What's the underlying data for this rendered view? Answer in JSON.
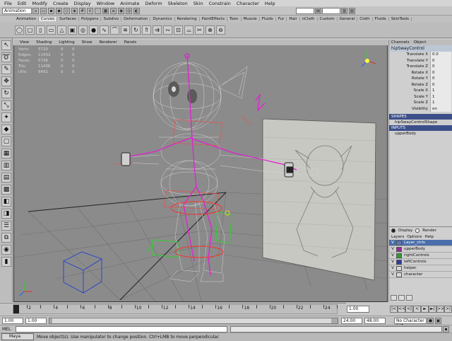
{
  "menubar": {
    "items": [
      "File",
      "Edit",
      "Modify",
      "Create",
      "Display",
      "Window",
      "Animate",
      "Deform",
      "Skeleton",
      "Skin",
      "Constrain",
      "Character",
      "Help"
    ]
  },
  "statusline": {
    "mode": "Animation",
    "field1": "",
    "field2": ""
  },
  "shelf": {
    "tabs": [
      "Animation",
      "Curves",
      "Surfaces",
      "Polygons",
      "Subdivs",
      "Deformation",
      "Dynamics",
      "Rendering",
      "PaintEffects",
      "Toon",
      "Muscle",
      "Fluids",
      "Fur",
      "Hair",
      "nCloth",
      "Custom",
      "General",
      "Cloth",
      "Fluids",
      "SkinTools"
    ],
    "active_tab": 1,
    "buttons": [
      "circle",
      "square",
      "cylinder",
      "plane",
      "cone",
      "cube",
      "torus",
      "sphere",
      "curve",
      "arc",
      "loft",
      "revolve",
      "extrude",
      "birail",
      "sweep",
      "boundary",
      "fillet",
      "trim",
      "attach",
      "detach"
    ]
  },
  "toolbox": {
    "tools": [
      "select",
      "lasso",
      "paint",
      "move",
      "rotate",
      "scale",
      "manip",
      "last",
      "layout-single",
      "layout-quad",
      "layout-side",
      "layout-stack",
      "layout-grid",
      "layout-persp",
      "layout-graph",
      "outliner",
      "hypergraph",
      "render",
      "script"
    ]
  },
  "viewport": {
    "menu": [
      "View",
      "Shading",
      "Lighting",
      "Show",
      "Renderer",
      "Panels"
    ],
    "hud": [
      {
        "label": "Verts:",
        "value": "5720",
        "a": "0",
        "b": "0"
      },
      {
        "label": "Edges:",
        "value": "11432",
        "a": "0",
        "b": "0"
      },
      {
        "label": "Faces:",
        "value": "5736",
        "a": "0",
        "b": "0"
      },
      {
        "label": "Tris:",
        "value": "11436",
        "a": "0",
        "b": "0"
      },
      {
        "label": "UVs:",
        "value": "6491",
        "a": "0",
        "b": "0"
      }
    ],
    "axis_x": "X",
    "axis_y": "Y",
    "axis_z": "Z"
  },
  "channelbox": {
    "tabs": [
      "Channels",
      "Object"
    ],
    "node": "hipSwayControl",
    "attrs": [
      {
        "label": "Translate X",
        "value": "0.0"
      },
      {
        "label": "Translate Y",
        "value": "0"
      },
      {
        "label": "Translate Z",
        "value": "0"
      },
      {
        "label": "Rotate X",
        "value": "0"
      },
      {
        "label": "Rotate Y",
        "value": "0"
      },
      {
        "label": "Rotate Z",
        "value": "0"
      },
      {
        "label": "Scale X",
        "value": "1"
      },
      {
        "label": "Scale Y",
        "value": "1"
      },
      {
        "label": "Scale Z",
        "value": "1"
      },
      {
        "label": "Visibility",
        "value": "on"
      }
    ],
    "shapes_header": "SHAPES",
    "shape_name": "hipSwayControlShape",
    "inputs_header": "INPUTS",
    "input_name": "upperBody"
  },
  "layers": {
    "radio_display": "Display",
    "radio_render": "Render",
    "menu": [
      "Layers",
      "Options",
      "Help"
    ],
    "rows": [
      {
        "v": "V",
        "color": "#5a78b3",
        "name": "Layer_ctrls",
        "selected": true
      },
      {
        "v": "V",
        "color": "#9a2a9a",
        "name": "upperBody",
        "selected": false
      },
      {
        "v": "V",
        "color": "#2e9d2e",
        "name": "rightControls",
        "selected": false
      },
      {
        "v": "V",
        "color": "#2c3e9d",
        "name": "leftControls",
        "selected": false
      },
      {
        "v": "V",
        "color": "#d8d8d8",
        "name": "helper",
        "selected": false
      },
      {
        "v": "V",
        "color": "#d8d8d8",
        "name": "character",
        "selected": false
      }
    ]
  },
  "timeslider": {
    "labels": [
      "2",
      "4",
      "6",
      "8",
      "10",
      "12",
      "14",
      "16",
      "18",
      "20",
      "22",
      "24"
    ],
    "current_time": "1.00",
    "playback": [
      "|<",
      "<<",
      "<|",
      "<",
      "►",
      "►|",
      ">>",
      ">|"
    ]
  },
  "rangeslider": {
    "start": "1.00",
    "start_inner": "1.00",
    "end_inner": "24.00",
    "end": "48.00",
    "character_set": "No Character Set"
  },
  "cmdline": {
    "label": "MEL",
    "text": ""
  },
  "helpline": {
    "taskbar_label": "Maya",
    "text": "Move object(s). Use manipulator to change position. Ctrl+LMB to move perpendicular."
  },
  "colors": {
    "viewport_bg": "#8b8b8b",
    "grid": "#6f6f6f",
    "skeleton": "#e020d0",
    "selection_green": "#19e019",
    "channel_sel": "#3c4f8a"
  }
}
